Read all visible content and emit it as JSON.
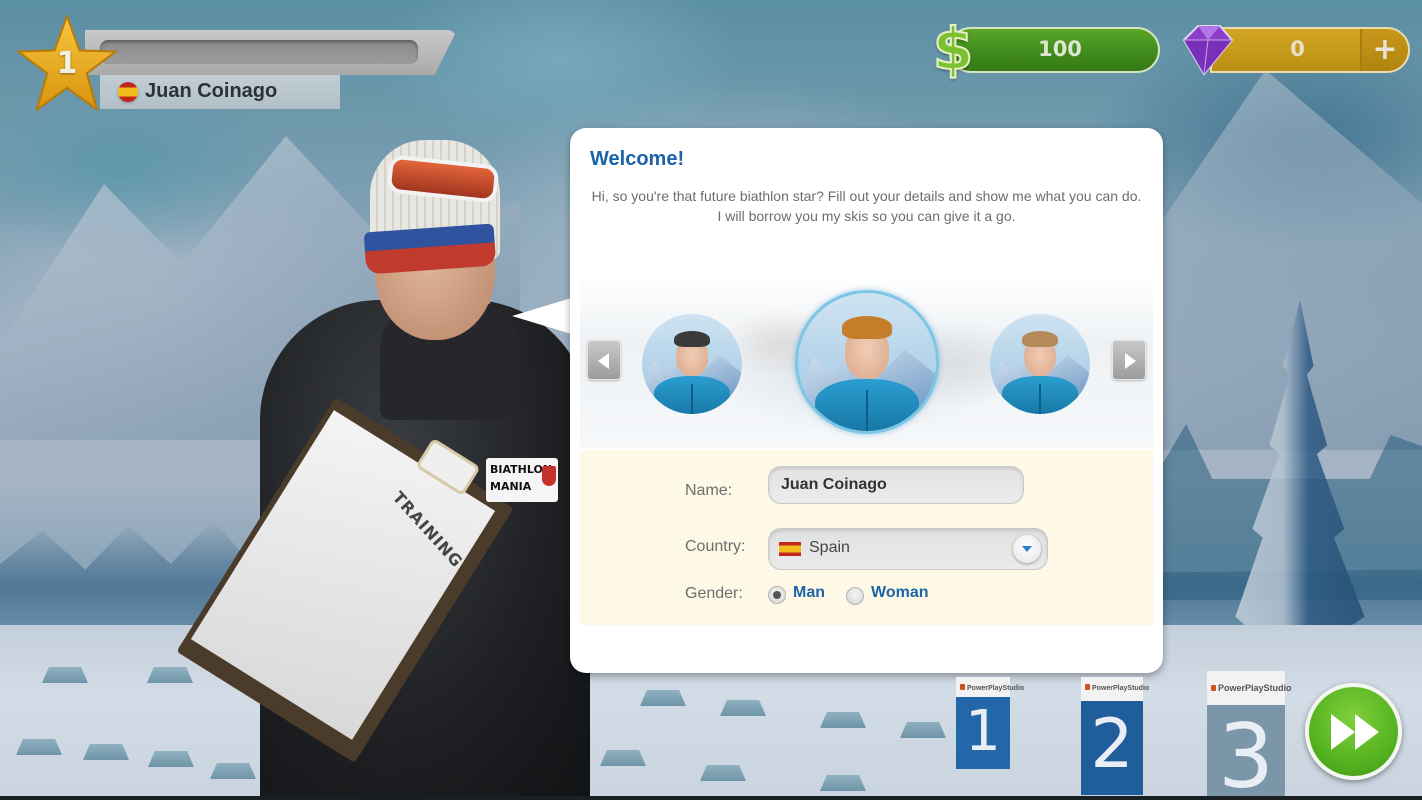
{
  "player": {
    "level": "1",
    "name": "Juan Coinago",
    "flag_icon": "spain-flag-icon",
    "xp_progress_percent": 0
  },
  "currency": {
    "cash_icon": "dollar-icon",
    "cash_value": "100",
    "gems_icon": "gem-icon",
    "gems_value": "0",
    "add_gems_label": "+"
  },
  "dialog": {
    "title": "Welcome!",
    "message": "Hi, so you're that future biathlon star? Fill out your details and show me what you can do. I will borrow you my skis so you can give it a go.",
    "avatar_carousel": {
      "prev_icon": "chevron-left-icon",
      "next_icon": "chevron-right-icon",
      "avatars": [
        {
          "id": "avatar-1",
          "hair": "dark",
          "selected": false
        },
        {
          "id": "avatar-2",
          "hair": "ginger",
          "selected": true
        },
        {
          "id": "avatar-3",
          "hair": "light",
          "selected": false
        }
      ]
    },
    "form": {
      "name_label": "Name:",
      "name_value": "Juan Coinago",
      "country_label": "Country:",
      "country_value": "Spain",
      "country_flag_icon": "spain-flag-icon",
      "gender_label": "Gender:",
      "gender_options": [
        {
          "label": "Man",
          "checked": true
        },
        {
          "label": "Woman",
          "checked": false
        }
      ]
    }
  },
  "coach": {
    "clipboard_text": "TRAINING",
    "patch_line1": "BIATHLON",
    "patch_line2": "MANIA"
  },
  "scene": {
    "bibs": [
      {
        "number": "1",
        "brand": "PowerPlayStudio"
      },
      {
        "number": "2",
        "brand": "PowerPlayStudio"
      },
      {
        "number": "3",
        "brand": "PowerPlayStudio"
      }
    ]
  },
  "continue_button": {
    "icon": "fast-forward-icon"
  },
  "colors": {
    "title_blue": "#1a63a8",
    "cash_green": "#3f8a1c",
    "gem_gold": "#c8981a",
    "gem_purple": "#8b3fc9",
    "continue_green": "#56b321",
    "form_background": "#fdf9e6"
  }
}
